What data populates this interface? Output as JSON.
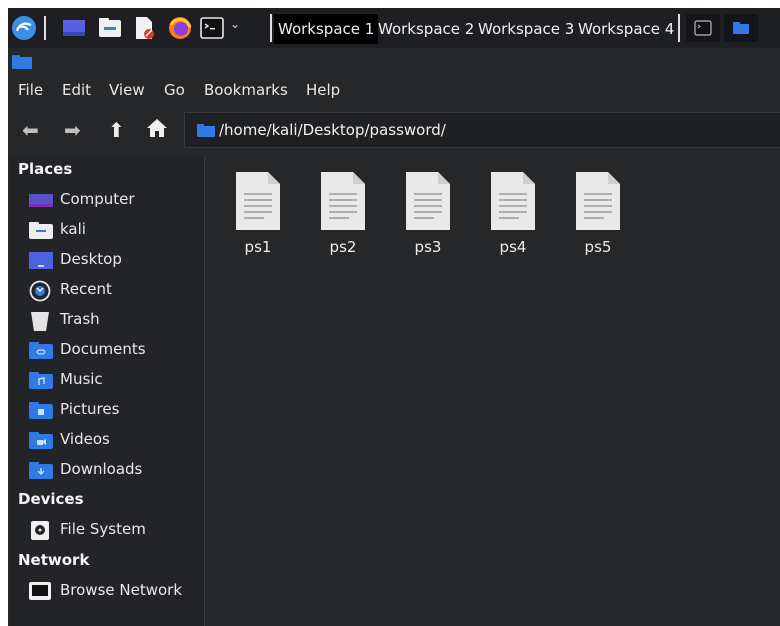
{
  "panel": {
    "workspaces": [
      "Workspace 1",
      "Workspace 2",
      "Workspace 3",
      "Workspace 4"
    ],
    "active_workspace": "Workspace 1",
    "launchers": [
      "kali-menu-icon",
      "show-desktop-icon",
      "file-manager-icon",
      "text-editor-icon",
      "firefox-icon",
      "terminal-icon"
    ],
    "taskbar": [
      "terminal-window-icon",
      "file-manager-window-icon"
    ]
  },
  "menubar": {
    "items": [
      "File",
      "Edit",
      "View",
      "Go",
      "Bookmarks",
      "Help"
    ]
  },
  "location": {
    "path": "/home/kali/Desktop/password/"
  },
  "sidebar": {
    "places_title": "Places",
    "places": [
      {
        "label": "Computer",
        "icon": "computer-icon"
      },
      {
        "label": "kali",
        "icon": "home-folder-icon"
      },
      {
        "label": "Desktop",
        "icon": "desktop-icon"
      },
      {
        "label": "Recent",
        "icon": "recent-icon"
      },
      {
        "label": "Trash",
        "icon": "trash-icon"
      },
      {
        "label": "Documents",
        "icon": "documents-folder-icon"
      },
      {
        "label": "Music",
        "icon": "music-folder-icon"
      },
      {
        "label": "Pictures",
        "icon": "pictures-folder-icon"
      },
      {
        "label": "Videos",
        "icon": "videos-folder-icon"
      },
      {
        "label": "Downloads",
        "icon": "downloads-folder-icon"
      }
    ],
    "devices_title": "Devices",
    "devices": [
      {
        "label": "File System",
        "icon": "drive-icon"
      }
    ],
    "network_title": "Network",
    "network": [
      {
        "label": "Browse Network",
        "icon": "network-icon"
      }
    ]
  },
  "files": [
    "ps1",
    "ps2",
    "ps3",
    "ps4",
    "ps5"
  ],
  "colors": {
    "panel": "#1e1f22",
    "window": "#262729",
    "sidebar": "#232427",
    "accent": "#2f7ae5"
  }
}
